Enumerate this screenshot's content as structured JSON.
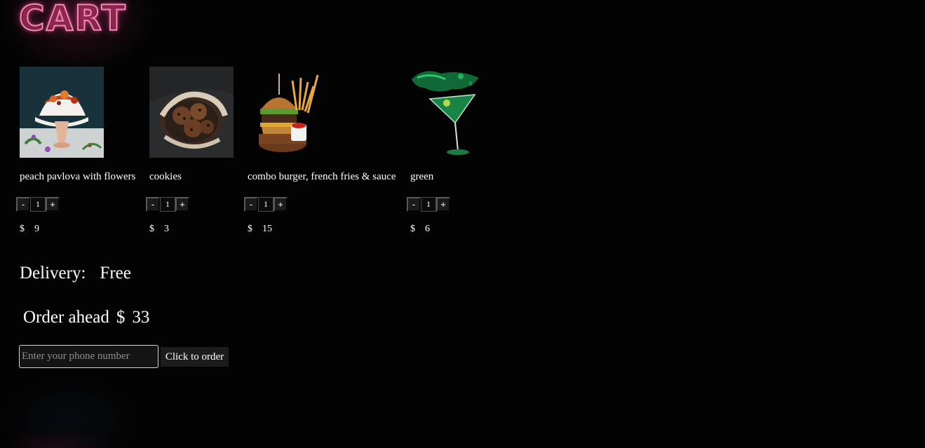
{
  "header": {
    "title": "CART"
  },
  "items": [
    {
      "name": "peach pavlova with flowers",
      "qty": "1",
      "currency": "$",
      "price": "9",
      "image_icon": "pavlova-photo"
    },
    {
      "name": "cookies",
      "qty": "1",
      "currency": "$",
      "price": "3",
      "image_icon": "cookies-photo"
    },
    {
      "name": "combo burger, french fries & sauce",
      "qty": "1",
      "currency": "$",
      "price": "15",
      "image_icon": "burger-photo"
    },
    {
      "name": "green",
      "qty": "1",
      "currency": "$",
      "price": "6",
      "image_icon": "cocktail-photo"
    }
  ],
  "controls": {
    "minus": "-",
    "plus": "+"
  },
  "delivery": {
    "label": "Delivery:",
    "value": "Free"
  },
  "total": {
    "label": "Order ahead",
    "currency": "$",
    "amount": "33"
  },
  "order_form": {
    "phone_placeholder": "Enter your phone number",
    "button_label": "Click to order"
  },
  "colors": {
    "background": "#030303",
    "title_neon": "#f08ab8",
    "text": "#ffffff"
  }
}
